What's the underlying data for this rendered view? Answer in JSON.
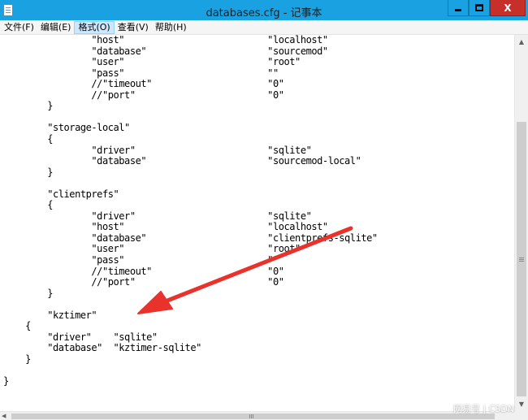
{
  "window": {
    "title": "databases.cfg - 记事本",
    "minimize_label": "",
    "maximize_label": "",
    "close_label": "X"
  },
  "menu": [
    {
      "label": "文件(F)"
    },
    {
      "label": "编辑(E)"
    },
    {
      "label": "格式(O)"
    },
    {
      "label": "查看(V)"
    },
    {
      "label": "帮助(H)"
    }
  ],
  "document_lines": [
    "\t\t\"host\"\t\t\t\t\"localhost\"",
    "\t\t\"database\"\t\t\t\"sourcemod\"",
    "\t\t\"user\"\t\t\t\t\"root\"",
    "\t\t\"pass\"\t\t\t\t\"\"",
    "\t\t//\"timeout\"\t\t\t\"0\"",
    "\t\t//\"port\"\t\t\t\"0\"",
    "\t}",
    "",
    "\t\"storage-local\"",
    "\t{",
    "\t\t\"driver\"\t\t\t\"sqlite\"",
    "\t\t\"database\"\t\t\t\"sourcemod-local\"",
    "\t}",
    "",
    "\t\"clientprefs\"",
    "\t{",
    "\t\t\"driver\"\t\t\t\"sqlite\"",
    "\t\t\"host\"\t\t\t\t\"localhost\"",
    "\t\t\"database\"\t\t\t\"clientprefs-sqlite\"",
    "\t\t\"user\"\t\t\t\t\"root\"",
    "\t\t\"pass\"\t\t\t\t\"\"",
    "\t\t//\"timeout\"\t\t\t\"0\"",
    "\t\t//\"port\"\t\t\t\"0\"",
    "\t}",
    "",
    "\t\"kztimer\"",
    "    {",
    "\t\"driver\"    \"sqlite\"",
    "\t\"database\"  \"kztimer-sqlite\"",
    "    }",
    "",
    "}"
  ],
  "watermark": "网易号 | CSDN",
  "colors": {
    "titlebar": "#1aa1e1",
    "close_button": "#c7302a",
    "annotation_arrow": "#e8322b"
  }
}
